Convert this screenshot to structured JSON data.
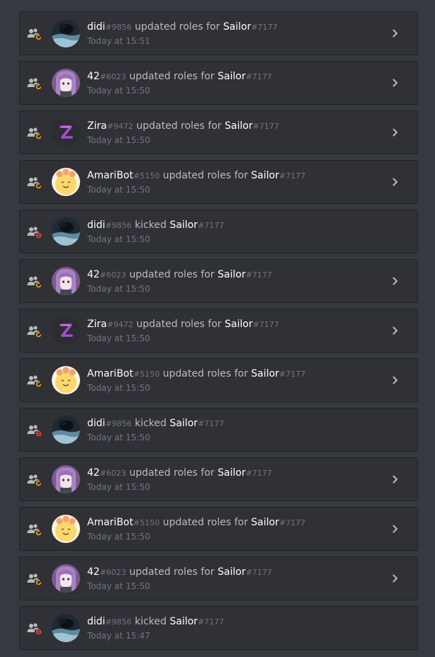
{
  "colors": {
    "background": "#36393f",
    "card": "#2f3136",
    "name": "#ffffff",
    "muted": "#72767d",
    "text": "#b9bbbe",
    "update_badge": "#faa61a",
    "kick_badge": "#f04747"
  },
  "entries": [
    {
      "actor": "didi",
      "actor_disc": "#9856",
      "action": "updated roles for",
      "target": "Sailor",
      "target_disc": "#7177",
      "time": "Today at 15:51",
      "action_icon": "member-update-icon",
      "avatar": "didi",
      "expandable": true
    },
    {
      "actor": "42",
      "actor_disc": "#6023",
      "action": "updated roles for",
      "target": "Sailor",
      "target_disc": "#7177",
      "time": "Today at 15:50",
      "action_icon": "member-update-icon",
      "avatar": "42",
      "expandable": true
    },
    {
      "actor": "Zira",
      "actor_disc": "#9472",
      "action": "updated roles for",
      "target": "Sailor",
      "target_disc": "#7177",
      "time": "Today at 15:50",
      "action_icon": "member-update-icon",
      "avatar": "zira",
      "expandable": true
    },
    {
      "actor": "AmariBot",
      "actor_disc": "#5150",
      "action": "updated roles for",
      "target": "Sailor",
      "target_disc": "#7177",
      "time": "Today at 15:50",
      "action_icon": "member-update-icon",
      "avatar": "amari",
      "expandable": true
    },
    {
      "actor": "didi",
      "actor_disc": "#9856",
      "action": "kicked",
      "target": "Sailor",
      "target_disc": "#7177",
      "time": "Today at 15:50",
      "action_icon": "member-kick-icon",
      "avatar": "didi",
      "expandable": false
    },
    {
      "actor": "42",
      "actor_disc": "#6023",
      "action": "updated roles for",
      "target": "Sailor",
      "target_disc": "#7177",
      "time": "Today at 15:50",
      "action_icon": "member-update-icon",
      "avatar": "42",
      "expandable": true
    },
    {
      "actor": "Zira",
      "actor_disc": "#9472",
      "action": "updated roles for",
      "target": "Sailor",
      "target_disc": "#7177",
      "time": "Today at 15:50",
      "action_icon": "member-update-icon",
      "avatar": "zira",
      "expandable": true
    },
    {
      "actor": "AmariBot",
      "actor_disc": "#5150",
      "action": "updated roles for",
      "target": "Sailor",
      "target_disc": "#7177",
      "time": "Today at 15:50",
      "action_icon": "member-update-icon",
      "avatar": "amari",
      "expandable": true
    },
    {
      "actor": "didi",
      "actor_disc": "#9856",
      "action": "kicked",
      "target": "Sailor",
      "target_disc": "#7177",
      "time": "Today at 15:50",
      "action_icon": "member-kick-icon",
      "avatar": "didi",
      "expandable": false
    },
    {
      "actor": "42",
      "actor_disc": "#6023",
      "action": "updated roles for",
      "target": "Sailor",
      "target_disc": "#7177",
      "time": "Today at 15:50",
      "action_icon": "member-update-icon",
      "avatar": "42",
      "expandable": true
    },
    {
      "actor": "AmariBot",
      "actor_disc": "#5150",
      "action": "updated roles for",
      "target": "Sailor",
      "target_disc": "#7177",
      "time": "Today at 15:50",
      "action_icon": "member-update-icon",
      "avatar": "amari",
      "expandable": true
    },
    {
      "actor": "42",
      "actor_disc": "#6023",
      "action": "updated roles for",
      "target": "Sailor",
      "target_disc": "#7177",
      "time": "Today at 15:50",
      "action_icon": "member-update-icon",
      "avatar": "42",
      "expandable": true
    },
    {
      "actor": "didi",
      "actor_disc": "#9856",
      "action": "kicked",
      "target": "Sailor",
      "target_disc": "#7177",
      "time": "Today at 15:47",
      "action_icon": "member-kick-icon",
      "avatar": "didi",
      "expandable": false
    }
  ]
}
